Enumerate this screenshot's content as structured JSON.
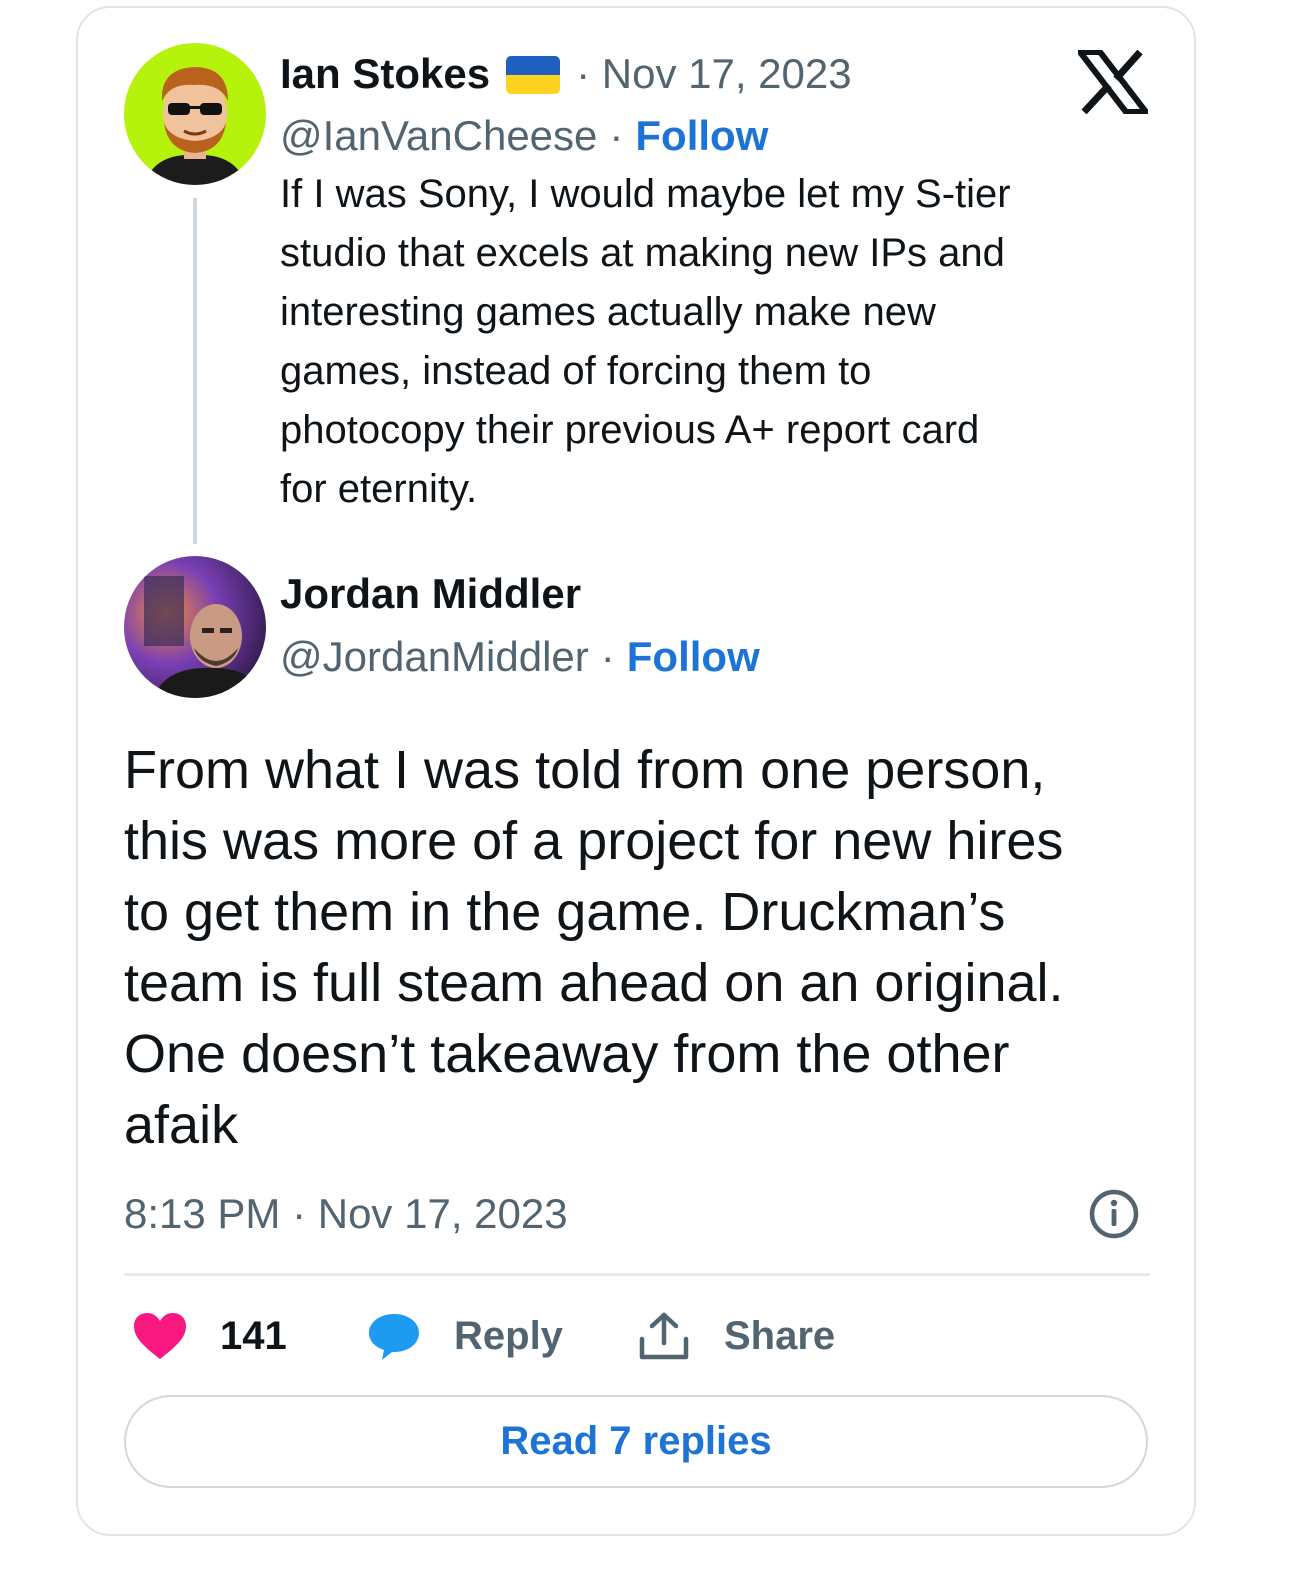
{
  "quoted_tweet": {
    "author_name": "Ian Stokes",
    "separator_date": "· Nov 17, 2023",
    "handle": "@IanVanCheese",
    "handle_separator": "·",
    "follow_label": "Follow",
    "lines": [
      "If I was Sony, I would maybe let my S-tier",
      "studio that excels at making new IPs and",
      "interesting games actually make new",
      "games, instead of forcing them to",
      "photocopy their previous A+ report card",
      "for eternity."
    ]
  },
  "main_tweet": {
    "author_name": "Jordan Middler",
    "handle": "@JordanMiddler",
    "handle_separator": "·",
    "follow_label": "Follow",
    "lines": [
      "From what I was told from one person,",
      "this was more of a project for new hires",
      "to get them in the game. Druckman’s",
      "team is full steam ahead on an original.",
      "One doesn’t takeaway from the other",
      "afaik"
    ],
    "timestamp": "8:13 PM · Nov 17, 2023"
  },
  "actions": {
    "like_count": "141",
    "reply_label": "Reply",
    "share_label": "Share"
  },
  "read_replies_label": "Read 7 replies",
  "icons": {
    "brand": "x-logo-icon",
    "flag": "ukraine-flag-icon",
    "info": "info-icon",
    "like": "heart-icon",
    "reply": "speech-bubble-icon",
    "share": "share-upload-icon"
  },
  "colors": {
    "follow": "#1d73d6",
    "like": "#f91880",
    "reply": "#1d9bf0",
    "muted": "#536471",
    "avatar1_bg": "#b5f20c"
  }
}
